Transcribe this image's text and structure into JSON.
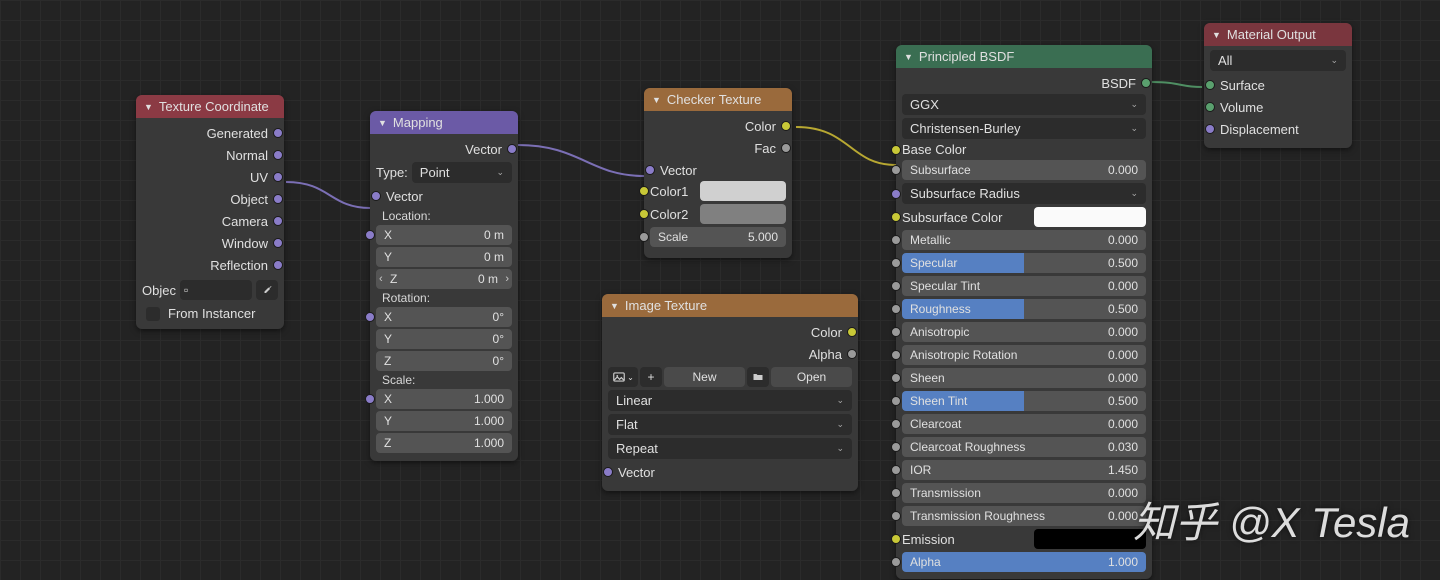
{
  "texcoord": {
    "title": "Texture Coordinate",
    "outputs": [
      "Generated",
      "Normal",
      "UV",
      "Object",
      "Camera",
      "Window",
      "Reflection"
    ],
    "object_label": "Objec",
    "from_instancer": "From Instancer"
  },
  "mapping": {
    "title": "Mapping",
    "vector_out": "Vector",
    "type_label": "Type:",
    "type_value": "Point",
    "vector_in": "Vector",
    "location_label": "Location:",
    "loc": {
      "x_l": "X",
      "x_v": "0 m",
      "y_l": "Y",
      "y_v": "0 m",
      "z_l": "Z",
      "z_v": "0 m"
    },
    "rotation_label": "Rotation:",
    "rot": {
      "x_l": "X",
      "x_v": "0°",
      "y_l": "Y",
      "y_v": "0°",
      "z_l": "Z",
      "z_v": "0°"
    },
    "scale_label": "Scale:",
    "scl": {
      "x_l": "X",
      "x_v": "1.000",
      "y_l": "Y",
      "y_v": "1.000",
      "z_l": "Z",
      "z_v": "1.000"
    }
  },
  "checker": {
    "title": "Checker Texture",
    "color_out": "Color",
    "fac_out": "Fac",
    "vector_in": "Vector",
    "color1": "Color1",
    "color2": "Color2",
    "scale_label": "Scale",
    "scale_value": "5.000"
  },
  "image": {
    "title": "Image Texture",
    "color_out": "Color",
    "alpha_out": "Alpha",
    "plus": "+",
    "new": "New",
    "open": "Open",
    "interp": "Linear",
    "proj": "Flat",
    "ext": "Repeat",
    "vector_in": "Vector"
  },
  "principled": {
    "title": "Principled BSDF",
    "bsdf_out": "BSDF",
    "distribution": "GGX",
    "sss_method": "Christensen-Burley",
    "base_color": "Base Color",
    "rows": [
      {
        "name": "Subsurface",
        "value": "0.000",
        "slider": "none",
        "sock": "grey"
      },
      {
        "name": "Subsurface Radius",
        "value": "",
        "slider": "dropdown",
        "sock": "purple"
      },
      {
        "name": "Subsurface Color",
        "value": "",
        "slider": "swatch-white",
        "sock": "yellow"
      },
      {
        "name": "Metallic",
        "value": "0.000",
        "slider": "none",
        "sock": "grey"
      },
      {
        "name": "Specular",
        "value": "0.500",
        "slider": "half",
        "sock": "grey"
      },
      {
        "name": "Specular Tint",
        "value": "0.000",
        "slider": "none",
        "sock": "grey"
      },
      {
        "name": "Roughness",
        "value": "0.500",
        "slider": "half",
        "sock": "grey"
      },
      {
        "name": "Anisotropic",
        "value": "0.000",
        "slider": "none",
        "sock": "grey"
      },
      {
        "name": "Anisotropic Rotation",
        "value": "0.000",
        "slider": "none",
        "sock": "grey"
      },
      {
        "name": "Sheen",
        "value": "0.000",
        "slider": "none",
        "sock": "grey"
      },
      {
        "name": "Sheen Tint",
        "value": "0.500",
        "slider": "half",
        "sock": "grey"
      },
      {
        "name": "Clearcoat",
        "value": "0.000",
        "slider": "none",
        "sock": "grey"
      },
      {
        "name": "Clearcoat Roughness",
        "value": "0.030",
        "slider": "none",
        "sock": "grey"
      },
      {
        "name": "IOR",
        "value": "1.450",
        "slider": "plain",
        "sock": "grey"
      },
      {
        "name": "Transmission",
        "value": "0.000",
        "slider": "none",
        "sock": "grey"
      },
      {
        "name": "Transmission Roughness",
        "value": "0.000",
        "slider": "none",
        "sock": "grey"
      },
      {
        "name": "Emission",
        "value": "",
        "slider": "swatch-black",
        "sock": "yellow"
      },
      {
        "name": "Alpha",
        "value": "1.000",
        "slider": "full",
        "sock": "grey"
      }
    ]
  },
  "matout": {
    "title": "Material Output",
    "target": "All",
    "surface": "Surface",
    "volume": "Volume",
    "displacement": "Displacement"
  },
  "watermark": "知乎 @X Tesla"
}
